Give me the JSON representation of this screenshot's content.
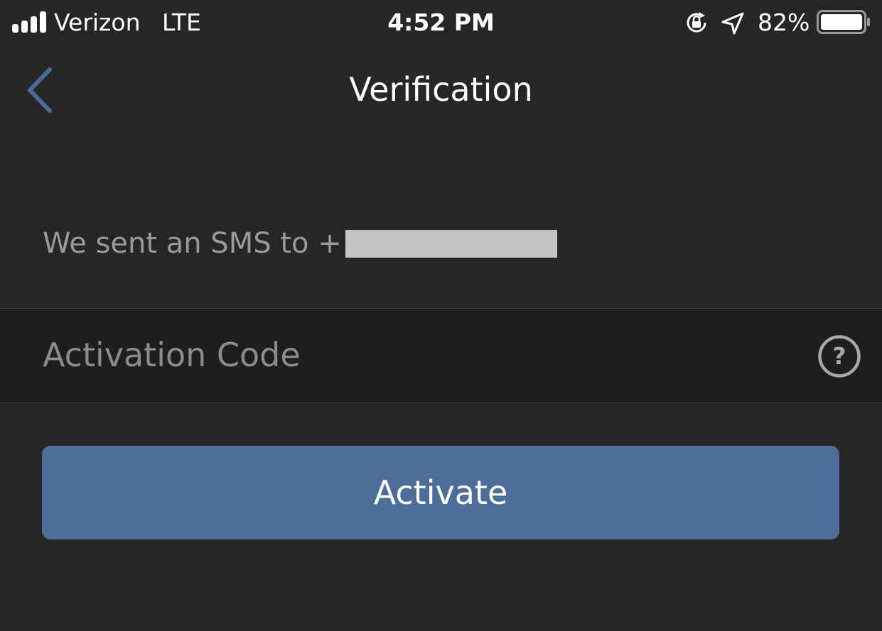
{
  "status_bar": {
    "carrier": "Verizon",
    "network": "LTE",
    "time": "4:52 PM",
    "battery_percent": "82%",
    "battery_level": 0.82,
    "icons": [
      "signal-bars-icon",
      "rotation-lock-icon",
      "location-arrow-icon",
      "battery-icon"
    ]
  },
  "nav": {
    "back_icon": "chevron-left-icon",
    "title": "Verification"
  },
  "message": {
    "text": "We sent an SMS to +"
  },
  "code_field": {
    "placeholder": "Activation Code",
    "value": "",
    "help_icon": "question-circle-icon"
  },
  "actions": {
    "activate_label": "Activate"
  },
  "colors": {
    "background": "#262626",
    "field_background": "#1e1e1e",
    "accent": "#4c6c9a",
    "back_icon": "#4a6a9a",
    "secondary_text": "#9a9a9a"
  }
}
